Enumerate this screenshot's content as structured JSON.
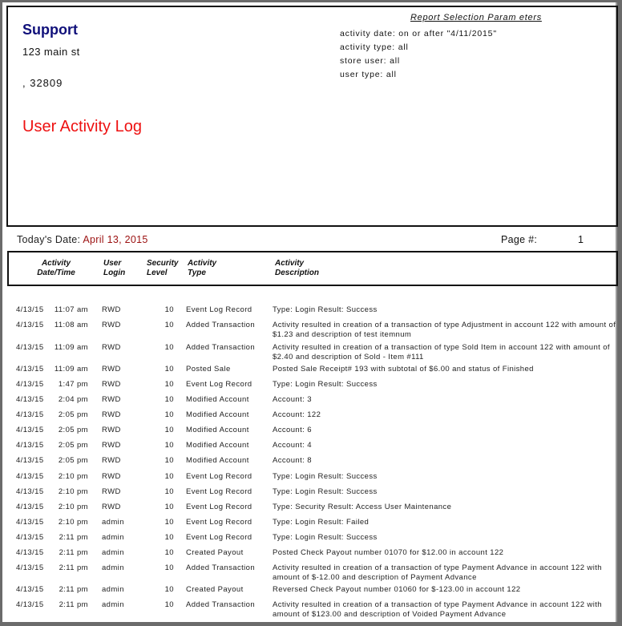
{
  "header": {
    "company_name": "Support",
    "address_line1": "123 main st",
    "address_line2": ", 32809",
    "report_title": "User Activity Log",
    "params_title": "Report Selection Param eters",
    "params": [
      "activity date: on or after \"4/11/2015\"",
      "activity type: all",
      "store user: all",
      "user type: all"
    ]
  },
  "subheader": {
    "today_label": "Today's Date:",
    "today_value": "April 13, 2015",
    "page_label": "Page #:",
    "page_value": "1"
  },
  "columns": {
    "date": [
      "Activity",
      "Date/Time"
    ],
    "user": [
      "User",
      "Login"
    ],
    "security": [
      "Security",
      "Level"
    ],
    "type": [
      "Activity",
      "Type"
    ],
    "description": [
      "Activity",
      "Description"
    ]
  },
  "rows": [
    {
      "date": "4/13/15",
      "time": "11:07 am",
      "user": "RWD",
      "level": "10",
      "type": "Event Log Record",
      "desc": "Type: Login    Result: Success"
    },
    {
      "date": "4/13/15",
      "time": "11:08 am",
      "user": "RWD",
      "level": "10",
      "type": "Added Transaction",
      "desc": "Activity resulted in creation of a transaction of type Adjustment in account 122 with amount of $1.23 and description of test itemnum"
    },
    {
      "date": "4/13/15",
      "time": "11:09 am",
      "user": "RWD",
      "level": "10",
      "type": "Added Transaction",
      "desc": "Activity resulted in creation of a transaction of type Sold Item in account 122 with amount of $2.40 and description of Sold - Item #111"
    },
    {
      "date": "4/13/15",
      "time": "11:09 am",
      "user": "RWD",
      "level": "10",
      "type": "Posted Sale",
      "desc": "Posted Sale Receipt# 193 with subtotal of $6.00 and status of Finished"
    },
    {
      "date": "4/13/15",
      "time": "1:47 pm",
      "user": "RWD",
      "level": "10",
      "type": "Event Log Record",
      "desc": "Type: Login    Result: Success"
    },
    {
      "date": "4/13/15",
      "time": "2:04 pm",
      "user": "RWD",
      "level": "10",
      "type": "Modified Account",
      "desc": "Account: 3"
    },
    {
      "date": "4/13/15",
      "time": "2:05 pm",
      "user": "RWD",
      "level": "10",
      "type": "Modified Account",
      "desc": "Account: 122"
    },
    {
      "date": "4/13/15",
      "time": "2:05 pm",
      "user": "RWD",
      "level": "10",
      "type": "Modified Account",
      "desc": "Account: 6"
    },
    {
      "date": "4/13/15",
      "time": "2:05 pm",
      "user": "RWD",
      "level": "10",
      "type": "Modified Account",
      "desc": "Account: 4"
    },
    {
      "date": "4/13/15",
      "time": "2:05 pm",
      "user": "RWD",
      "level": "10",
      "type": "Modified Account",
      "desc": "Account: 8"
    },
    {
      "date": "4/13/15",
      "time": "2:10 pm",
      "user": "RWD",
      "level": "10",
      "type": "Event Log Record",
      "desc": "Type: Login    Result: Success"
    },
    {
      "date": "4/13/15",
      "time": "2:10 pm",
      "user": "RWD",
      "level": "10",
      "type": "Event Log Record",
      "desc": "Type: Login    Result: Success"
    },
    {
      "date": "4/13/15",
      "time": "2:10 pm",
      "user": "RWD",
      "level": "10",
      "type": "Event Log Record",
      "desc": "Type: Security    Result: Access User Maintenance"
    },
    {
      "date": "4/13/15",
      "time": "2:10 pm",
      "user": "admin",
      "level": "10",
      "type": "Event Log Record",
      "desc": "Type: Login    Result: Failed"
    },
    {
      "date": "4/13/15",
      "time": "2:11 pm",
      "user": "admin",
      "level": "10",
      "type": "Event Log Record",
      "desc": "Type: Login    Result: Success"
    },
    {
      "date": "4/13/15",
      "time": "2:11 pm",
      "user": "admin",
      "level": "10",
      "type": "Created Payout",
      "desc": "Posted Check Payout number 01070 for $12.00 in account 122"
    },
    {
      "date": "4/13/15",
      "time": "2:11 pm",
      "user": "admin",
      "level": "10",
      "type": "Added Transaction",
      "desc": "Activity resulted in creation of a transaction of type Payment Advance in account 122 with amount of $-12.00 and description of Payment Advance"
    },
    {
      "date": "4/13/15",
      "time": "2:11 pm",
      "user": "admin",
      "level": "10",
      "type": "Created Payout",
      "desc": "Reversed Check Payout number 01060 for $-123.00 in account 122"
    },
    {
      "date": "4/13/15",
      "time": "2:11 pm",
      "user": "admin",
      "level": "10",
      "type": "Added Transaction",
      "desc": "Activity resulted in creation of a transaction of type Payment Advance in account 122 with amount of $123.00 and description of Voided Payment Advance"
    }
  ]
}
